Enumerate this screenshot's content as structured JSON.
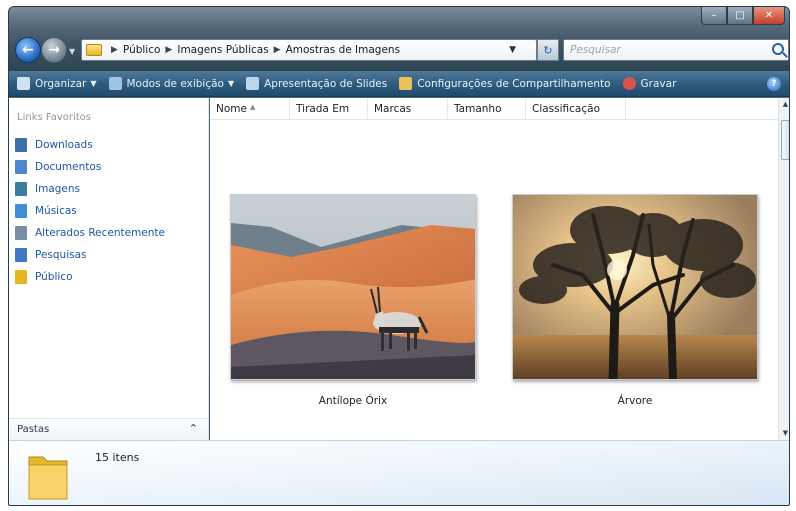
{
  "address": {
    "crumbs": [
      "Público",
      "Imagens Públicas",
      "Amostras de Imagens"
    ],
    "search_placeholder": "Pesquisar"
  },
  "toolbar": {
    "organize": "Organizar",
    "views": "Modos de exibição",
    "slideshow": "Apresentação de Slides",
    "sharing": "Configurações de Compartilhamento",
    "burn": "Gravar"
  },
  "sidebar": {
    "title": "Links Favoritos",
    "items": [
      {
        "label": "Downloads",
        "color": "#3f6fa8"
      },
      {
        "label": "Documentos",
        "color": "#4f86c9"
      },
      {
        "label": "Imagens",
        "color": "#3a7d9c"
      },
      {
        "label": "Músicas",
        "color": "#3f8ed6"
      },
      {
        "label": "Alterados Recentemente",
        "color": "#7a8ea3"
      },
      {
        "label": "Pesquisas",
        "color": "#3f77c2"
      },
      {
        "label": "Público",
        "color": "#e6b422"
      }
    ],
    "folders_label": "Pastas"
  },
  "columns": [
    "Nome",
    "Tirada Em",
    "Marcas",
    "Tamanho",
    "Classificação"
  ],
  "files": [
    {
      "name": "Antílope Órix"
    },
    {
      "name": "Árvore"
    }
  ],
  "details": {
    "count": "15 itens"
  }
}
